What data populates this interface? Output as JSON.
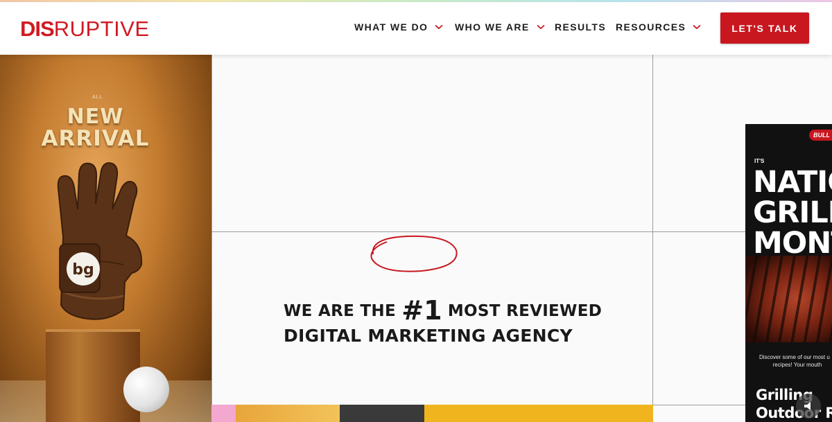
{
  "brand": {
    "logo_bold": "DIS",
    "logo_thin": "RUPTIVE",
    "accent": "#c8171f"
  },
  "nav": {
    "items": [
      {
        "label": "WHAT WE DO",
        "has_dropdown": true
      },
      {
        "label": "WHO WE ARE",
        "has_dropdown": true
      },
      {
        "label": "RESULTS",
        "has_dropdown": false
      },
      {
        "label": "RESOURCES",
        "has_dropdown": true
      }
    ],
    "cta_label": "LET'S TALK"
  },
  "hero": {
    "left_tile": {
      "small": "ALL",
      "line1": "NEW",
      "line2": "ARRIVAL",
      "glove_badge": "bg"
    },
    "headline": {
      "pre": "WE ARE THE ",
      "number": "#1",
      "post": " MOST REVIEWED",
      "line2": "DIGITAL MARKETING AGENCY"
    },
    "right_tile": {
      "brand": "BULL",
      "eyebrow": "IT'S",
      "title_lines": [
        "NATIO",
        "GRILLI",
        "MONTH"
      ],
      "desc_lines": [
        "Discover some of our most u",
        "recipes! Your mouth"
      ],
      "bottom_lines": [
        "Grilling",
        "Outdoor R"
      ]
    }
  }
}
